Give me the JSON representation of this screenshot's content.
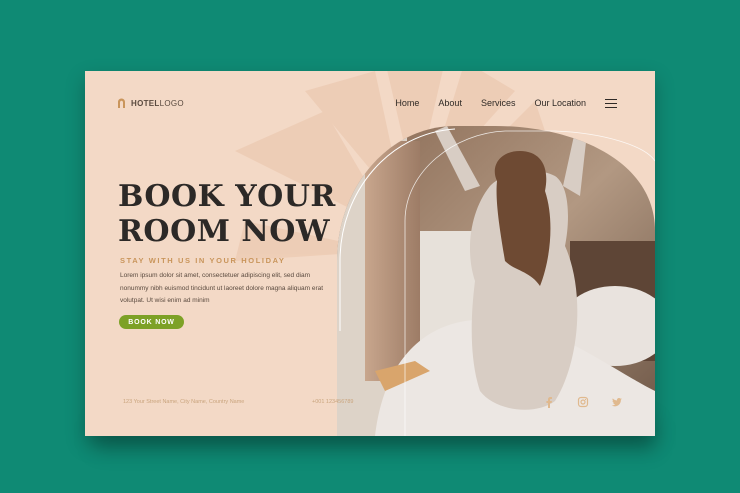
{
  "logo": {
    "brand": "HOTEL",
    "suffix": "LOGO"
  },
  "nav": {
    "items": [
      {
        "label": "Home"
      },
      {
        "label": "About"
      },
      {
        "label": "Services"
      },
      {
        "label": "Our Location"
      }
    ]
  },
  "hero": {
    "title_line1": "BOOK YOUR",
    "title_line2": "ROOM NOW",
    "subtitle": "STAY WITH US IN YOUR HOLIDAY",
    "body": "Lorem ipsum dolor sit amet, consectetuer adipiscing elit, sed diam nonummy nibh euismod tincidunt ut laoreet dolore magna aliquam erat volutpat. Ut wisi enim ad minim",
    "button_label": "BOOK NOW"
  },
  "footer": {
    "address": "123 Your Street Name, City Name, Country Name",
    "phone": "+001 123456789"
  },
  "icons": {
    "menu": "hamburger-menu-icon",
    "socials": [
      "facebook-icon",
      "instagram-icon",
      "twitter-icon"
    ]
  },
  "colors": {
    "background": "#0f8a74",
    "card": "#f3d9c6",
    "accent_gold": "#c9955b",
    "button_green": "#7da126",
    "headline": "#2c2927"
  }
}
